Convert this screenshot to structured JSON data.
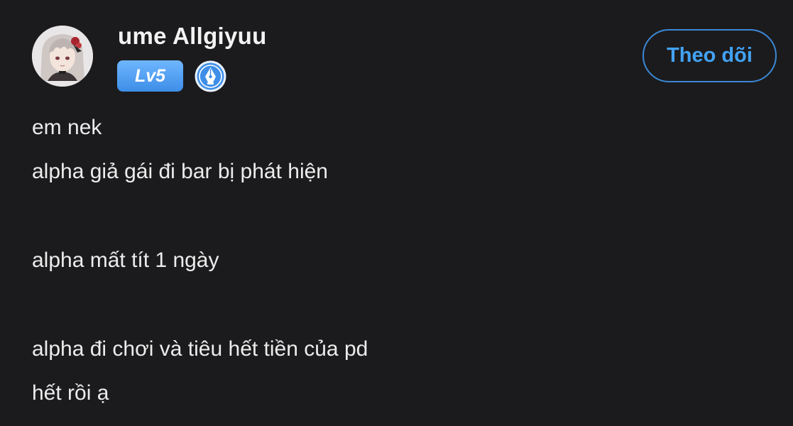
{
  "post": {
    "author": {
      "name": "ume Allgiyuu",
      "level": "Lv5",
      "creator_badge_icon": "pen-nib-icon"
    },
    "follow_label": "Theo dõi",
    "lines": [
      "em nek",
      "alpha giả gái đi bar bị phát hiện",
      "alpha mất tít 1 ngày",
      "alpha đi chơi và tiêu hết tiền của pd",
      "hết rồi ạ"
    ]
  },
  "colors": {
    "background": "#1b1b1d",
    "accent": "#42a2f5",
    "level_badge": "#4a9af0"
  }
}
